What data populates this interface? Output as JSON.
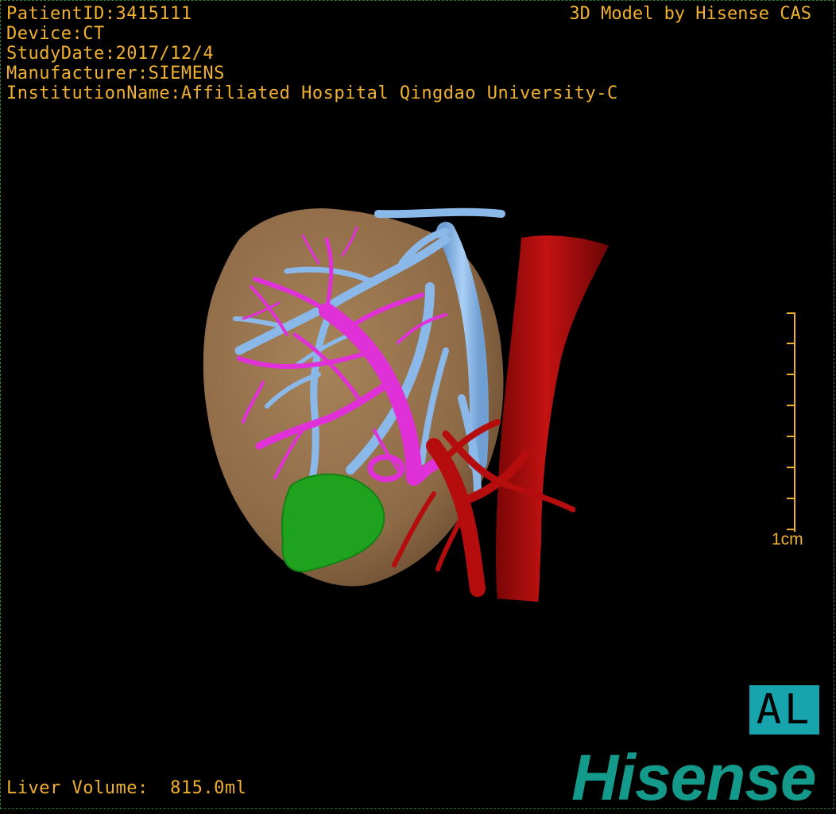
{
  "header": {
    "patient_id": "PatientID:3415111",
    "device": "Device:CT",
    "study_date": "StudyDate:2017/12/4",
    "manufacturer": "Manufacturer:SIEMENS",
    "institution": "InstitutionName:Affiliated Hospital Qingdao University-C",
    "credit": "3D Model by Hisense CAS"
  },
  "scale": {
    "label": "1cm"
  },
  "orientation": {
    "label": "AL"
  },
  "footer": {
    "liver_volume": "Liver Volume:  815.0ml",
    "logo": "Hisense"
  },
  "colors": {
    "overlay_text": "#f0b030",
    "liver": "#9c7750",
    "portal_vein": "#e030d8",
    "hepatic_vein": "#8ab8e8",
    "artery": "#b50d0d",
    "lesion": "#1fa31f",
    "brand": "#139a8b"
  },
  "icons": {
    "orientation": "orientation-cube-icon",
    "logo": "hisense-logo"
  }
}
